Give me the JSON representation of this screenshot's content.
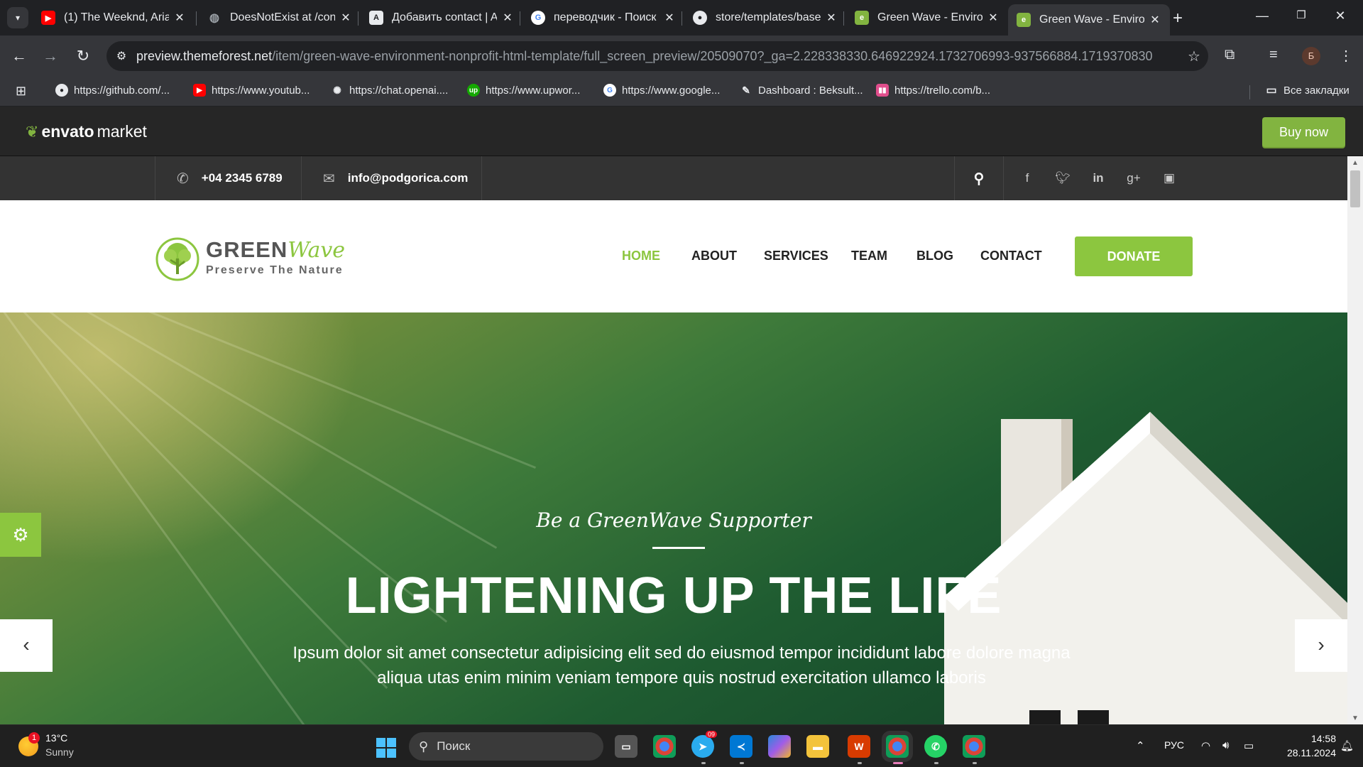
{
  "browser": {
    "tabs": [
      {
        "title": "(1) The Weeknd, Ariana",
        "icon": "youtube-icon",
        "color": "#ff0000"
      },
      {
        "title": "DoesNotExist at /con",
        "icon": "globe-icon",
        "color": "#9aa0a6"
      },
      {
        "title": "Добавить contact | A",
        "icon": "django-icon",
        "color": "#e8eaed"
      },
      {
        "title": "переводчик - Поиск",
        "icon": "google-icon",
        "color": "#4285f4"
      },
      {
        "title": "store/templates/base",
        "icon": "github-icon",
        "color": "#e8eaed"
      },
      {
        "title": "Green Wave - Environ",
        "icon": "envato-icon",
        "color": "#82b440"
      },
      {
        "title": "Green Wave - Environ",
        "icon": "envato-icon",
        "color": "#82b440"
      }
    ],
    "url_host": "preview.themeforest.net",
    "url_path": "/item/green-wave-environment-nonprofit-html-template/full_screen_preview/20509070?_ga=2.228338330.646922924.1732706993-937566884.1719370830",
    "profile_initial": "Б",
    "bookmarks": [
      {
        "label": "https://github.com/...",
        "icon": "github-icon"
      },
      {
        "label": "https://www.youtub...",
        "icon": "youtube-icon"
      },
      {
        "label": "https://chat.openai....",
        "icon": "openai-icon"
      },
      {
        "label": "https://www.upwor...",
        "icon": "upwork-icon"
      },
      {
        "label": "https://www.google...",
        "icon": "google-icon"
      },
      {
        "label": "Dashboard : Beksult...",
        "icon": "feather-icon"
      },
      {
        "label": "https://trello.com/b...",
        "icon": "trello-icon"
      }
    ],
    "all_bookmarks": "Все закладки"
  },
  "envato": {
    "logo_bold": "envato",
    "logo_market": "market",
    "buy_now": "Buy now",
    "accent": "#82b440"
  },
  "site": {
    "phone": "+04 2345 6789",
    "email": "info@podgorica.com",
    "social_icons": [
      "facebook-icon",
      "twitter-icon",
      "linkedin-icon",
      "google-plus-icon",
      "vimeo-icon"
    ],
    "logo_green": "GREEN",
    "logo_wave": "Wave",
    "logo_tagline": "Preserve The Nature",
    "nav": [
      "HOME",
      "ABOUT",
      "SERVICES",
      "TEAM",
      "BLOG",
      "CONTACT"
    ],
    "active_nav": "HOME",
    "donate": "DONATE",
    "accent": "#8cc63f",
    "hero": {
      "subtitle": "Be a GreenWave Supporter",
      "title": "LIGHTENING UP THE LIFE",
      "text_line1": "Ipsum dolor sit amet consectetur adipisicing elit sed do eiusmod tempor incididunt labore dolore magna",
      "text_line2": "aliqua utas enim minim veniam tempore quis nostrud exercitation ullamco laboris",
      "prev": "‹",
      "next": "›"
    }
  },
  "taskbar": {
    "weather_temp": "13°C",
    "weather_desc": "Sunny",
    "weather_badge": "1",
    "search_placeholder": "Поиск",
    "language": "РУС",
    "time": "14:58",
    "date": "28.11.2024",
    "telegram_badge": "09"
  }
}
